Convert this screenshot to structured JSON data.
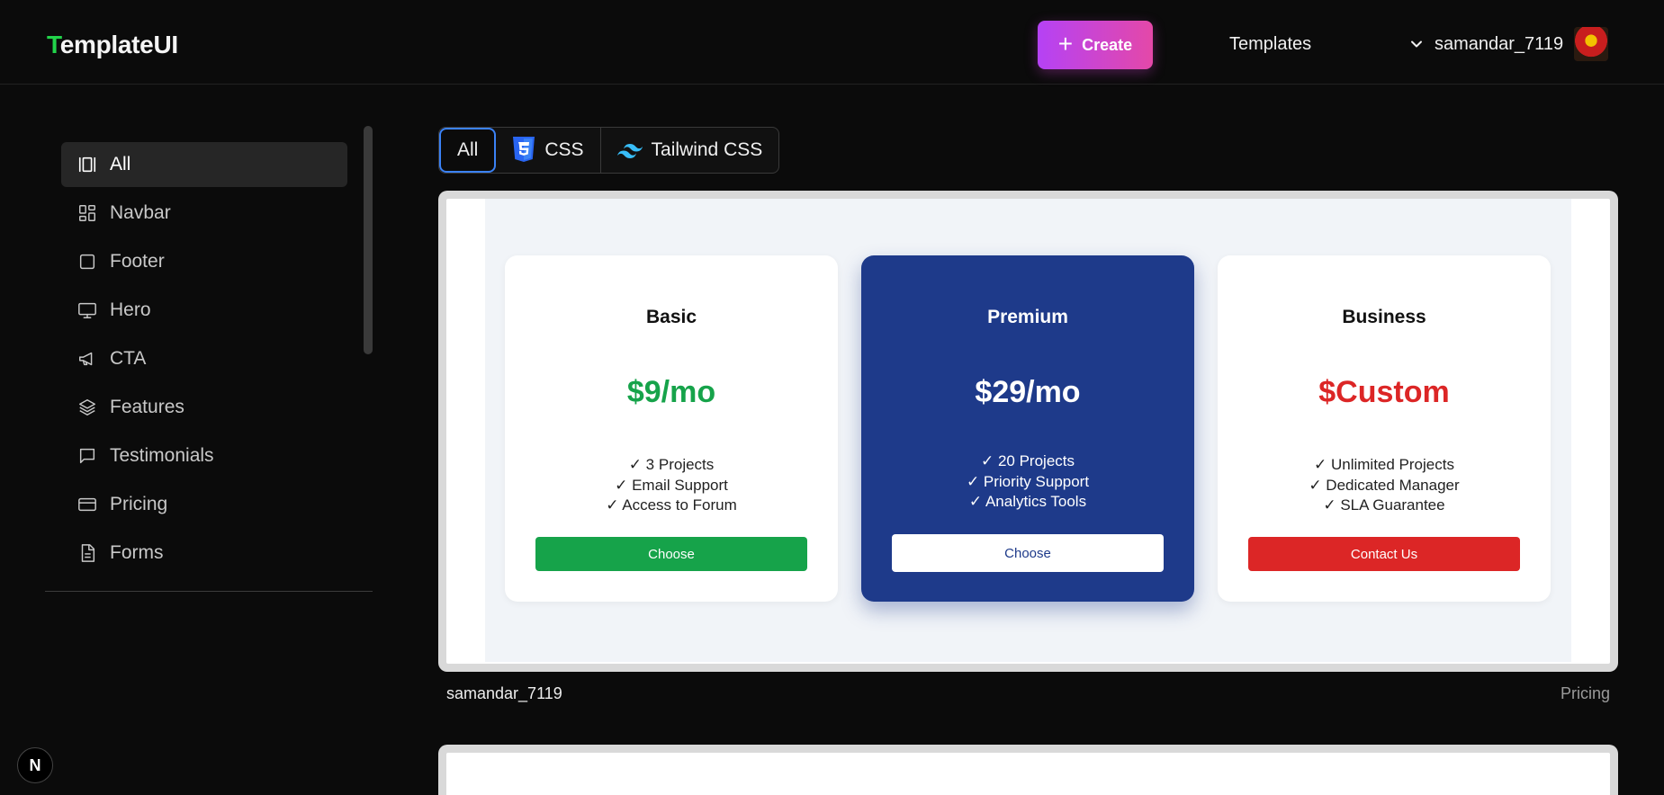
{
  "header": {
    "logo_first": "T",
    "logo_rest": "emplateUI",
    "create_label": "Create",
    "templates_label": "Templates",
    "username": "samandar_7119"
  },
  "sidebar": {
    "items": [
      {
        "label": "All",
        "icon": "library-icon",
        "active": true
      },
      {
        "label": "Navbar",
        "icon": "layout-grid-icon"
      },
      {
        "label": "Footer",
        "icon": "square-icon"
      },
      {
        "label": "Hero",
        "icon": "monitor-icon"
      },
      {
        "label": "CTA",
        "icon": "megaphone-icon"
      },
      {
        "label": "Features",
        "icon": "layers-icon"
      },
      {
        "label": "Testimonials",
        "icon": "message-square-icon"
      },
      {
        "label": "Pricing",
        "icon": "credit-card-icon"
      },
      {
        "label": "Forms",
        "icon": "file-text-icon"
      }
    ]
  },
  "filters": {
    "all": "All",
    "css": "CSS",
    "tailwind": "Tailwind CSS"
  },
  "preview": {
    "plans": [
      {
        "name": "Basic",
        "price": "$9/mo",
        "price_color": "#16a34a",
        "features": [
          "✓ 3 Projects",
          "✓ Email Support",
          "✓ Access to Forum"
        ],
        "button": "Choose",
        "button_color": "#16a34a"
      },
      {
        "name": "Premium",
        "price": "$29/mo",
        "price_color": "#ffffff",
        "features": [
          "✓ 20 Projects",
          "✓ Priority Support",
          "✓ Analytics Tools"
        ],
        "button": "Choose",
        "button_color": "#ffffff"
      },
      {
        "name": "Business",
        "price": "$Custom",
        "price_color": "#dc2626",
        "features": [
          "✓ Unlimited Projects",
          "✓ Dedicated Manager",
          "✓ SLA Guarantee"
        ],
        "button": "Contact Us",
        "button_color": "#dc2626"
      }
    ],
    "author": "samandar_7119",
    "category": "Pricing"
  },
  "next_badge": "N",
  "colors": {
    "accent_blue": "#3b82f6",
    "premium_bg": "#1e3a8a",
    "logo_green": "#22d34a"
  }
}
